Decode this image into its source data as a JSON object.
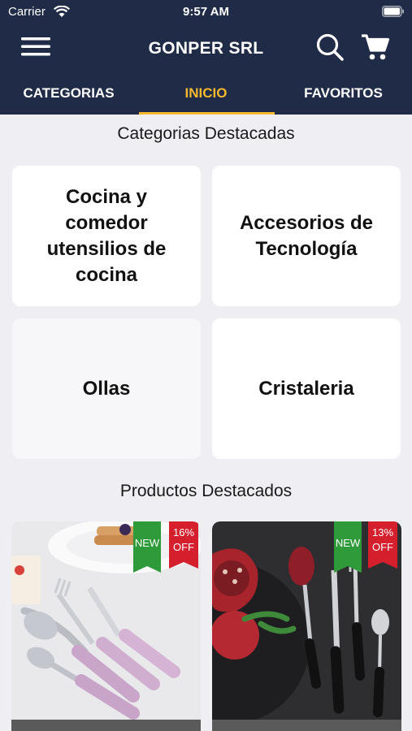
{
  "status_bar": {
    "carrier": "Carrier",
    "time": "9:57 AM"
  },
  "header": {
    "title": "GONPER SRL",
    "icons": [
      "menu-icon",
      "search-icon",
      "cart-icon"
    ]
  },
  "tabs": [
    {
      "label": "CATEGORIAS",
      "active": false
    },
    {
      "label": "INICIO",
      "active": true
    },
    {
      "label": "FAVORITOS",
      "active": false
    }
  ],
  "featured_categories": {
    "title": "Categorias Destacadas",
    "items": [
      {
        "label": "Cocina y comedor utensilios de cocina"
      },
      {
        "label": "Accesorios de Tecnología"
      },
      {
        "label": "Ollas"
      },
      {
        "label": "Cristaleria"
      }
    ]
  },
  "featured_products": {
    "title": "Productos Destacados",
    "items": [
      {
        "badge_new": "NEW",
        "discount_pct": "16%",
        "discount_off": "OFF"
      },
      {
        "badge_new": "NEW",
        "discount_pct": "13%",
        "discount_off": "OFF"
      }
    ]
  },
  "colors": {
    "header_bg": "#1f2b47",
    "accent": "#f5b82e",
    "page_bg": "#eeeef3",
    "badge_new": "#2f9a3a",
    "badge_off": "#d61f2c"
  }
}
